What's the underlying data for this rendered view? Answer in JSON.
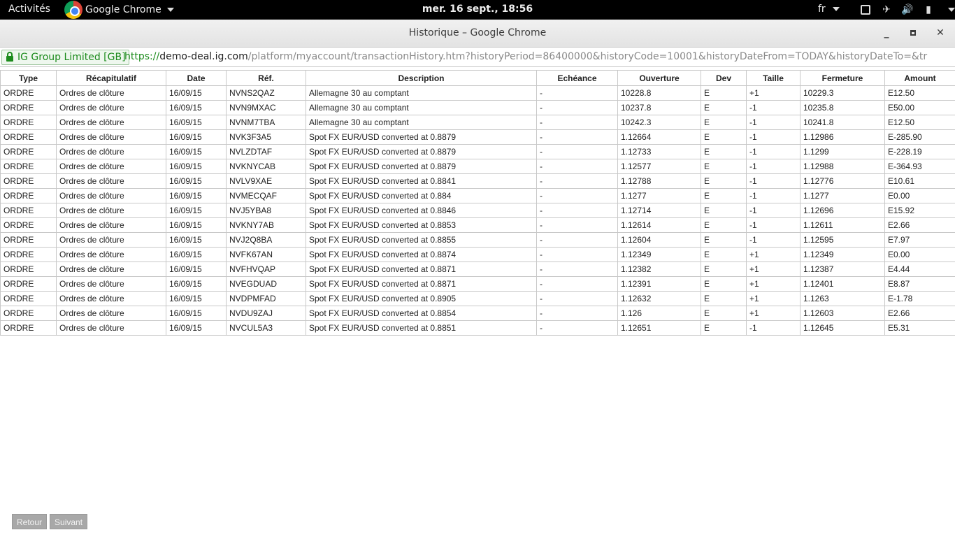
{
  "system_bar": {
    "activities": "Activités",
    "app_name": "Google Chrome",
    "clock": "mer. 16 sept., 18:56",
    "lang": "fr"
  },
  "window": {
    "title": "Historique – Google Chrome"
  },
  "address_bar": {
    "secure_label": "IG Group Limited [GB]",
    "url_scheme": "https://",
    "url_host": "demo-deal.ig.com",
    "url_path": "/platform/myaccount/transactionHistory.htm?historyPeriod=86400000&historyCode=10001&historyDateFrom=TODAY&historyDateTo=&tr"
  },
  "table": {
    "headers": [
      "Type",
      "Récapitulatif",
      "Date",
      "Réf.",
      "Description",
      "Echéance",
      "Ouverture",
      "Dev",
      "Taille",
      "Fermeture",
      "Amount"
    ],
    "rows": [
      [
        "ORDRE",
        "Ordres de clôture",
        "16/09/15",
        "NVNS2QAZ",
        "Allemagne 30 au comptant",
        "-",
        "10228.8",
        "E",
        "+1",
        "10229.3",
        "E12.50"
      ],
      [
        "ORDRE",
        "Ordres de clôture",
        "16/09/15",
        "NVN9MXAC",
        "Allemagne 30 au comptant",
        "-",
        "10237.8",
        "E",
        "-1",
        "10235.8",
        "E50.00"
      ],
      [
        "ORDRE",
        "Ordres de clôture",
        "16/09/15",
        "NVNM7TBA",
        "Allemagne 30 au comptant",
        "-",
        "10242.3",
        "E",
        "-1",
        "10241.8",
        "E12.50"
      ],
      [
        "ORDRE",
        "Ordres de clôture",
        "16/09/15",
        "NVK3F3A5",
        "Spot FX EUR/USD converted at 0.8879",
        "-",
        "1.12664",
        "E",
        "-1",
        "1.12986",
        "E-285.90"
      ],
      [
        "ORDRE",
        "Ordres de clôture",
        "16/09/15",
        "NVLZDTAF",
        "Spot FX EUR/USD converted at 0.8879",
        "-",
        "1.12733",
        "E",
        "-1",
        "1.1299",
        "E-228.19"
      ],
      [
        "ORDRE",
        "Ordres de clôture",
        "16/09/15",
        "NVKNYCAB",
        "Spot FX EUR/USD converted at 0.8879",
        "-",
        "1.12577",
        "E",
        "-1",
        "1.12988",
        "E-364.93"
      ],
      [
        "ORDRE",
        "Ordres de clôture",
        "16/09/15",
        "NVLV9XAE",
        "Spot FX EUR/USD converted at 0.8841",
        "-",
        "1.12788",
        "E",
        "-1",
        "1.12776",
        "E10.61"
      ],
      [
        "ORDRE",
        "Ordres de clôture",
        "16/09/15",
        "NVMECQAF",
        "Spot FX EUR/USD converted at 0.884",
        "-",
        "1.1277",
        "E",
        "-1",
        "1.1277",
        "E0.00"
      ],
      [
        "ORDRE",
        "Ordres de clôture",
        "16/09/15",
        "NVJ5YBA8",
        "Spot FX EUR/USD converted at 0.8846",
        "-",
        "1.12714",
        "E",
        "-1",
        "1.12696",
        "E15.92"
      ],
      [
        "ORDRE",
        "Ordres de clôture",
        "16/09/15",
        "NVKNY7AB",
        "Spot FX EUR/USD converted at 0.8853",
        "-",
        "1.12614",
        "E",
        "-1",
        "1.12611",
        "E2.66"
      ],
      [
        "ORDRE",
        "Ordres de clôture",
        "16/09/15",
        "NVJ2Q8BA",
        "Spot FX EUR/USD converted at 0.8855",
        "-",
        "1.12604",
        "E",
        "-1",
        "1.12595",
        "E7.97"
      ],
      [
        "ORDRE",
        "Ordres de clôture",
        "16/09/15",
        "NVFK67AN",
        "Spot FX EUR/USD converted at 0.8874",
        "-",
        "1.12349",
        "E",
        "+1",
        "1.12349",
        "E0.00"
      ],
      [
        "ORDRE",
        "Ordres de clôture",
        "16/09/15",
        "NVFHVQAP",
        "Spot FX EUR/USD converted at 0.8871",
        "-",
        "1.12382",
        "E",
        "+1",
        "1.12387",
        "E4.44"
      ],
      [
        "ORDRE",
        "Ordres de clôture",
        "16/09/15",
        "NVEGDUAD",
        "Spot FX EUR/USD converted at 0.8871",
        "-",
        "1.12391",
        "E",
        "+1",
        "1.12401",
        "E8.87"
      ],
      [
        "ORDRE",
        "Ordres de clôture",
        "16/09/15",
        "NVDPMFAD",
        "Spot FX EUR/USD converted at 0.8905",
        "-",
        "1.12632",
        "E",
        "+1",
        "1.1263",
        "E-1.78"
      ],
      [
        "ORDRE",
        "Ordres de clôture",
        "16/09/15",
        "NVDU9ZAJ",
        "Spot FX EUR/USD converted at 0.8854",
        "-",
        "1.126",
        "E",
        "+1",
        "1.12603",
        "E2.66"
      ],
      [
        "ORDRE",
        "Ordres de clôture",
        "16/09/15",
        "NVCUL5A3",
        "Spot FX EUR/USD converted at 0.8851",
        "-",
        "1.12651",
        "E",
        "-1",
        "1.12645",
        "E5.31"
      ]
    ]
  },
  "pager": {
    "prev_label": "Retour",
    "next_label": "Suivant"
  }
}
